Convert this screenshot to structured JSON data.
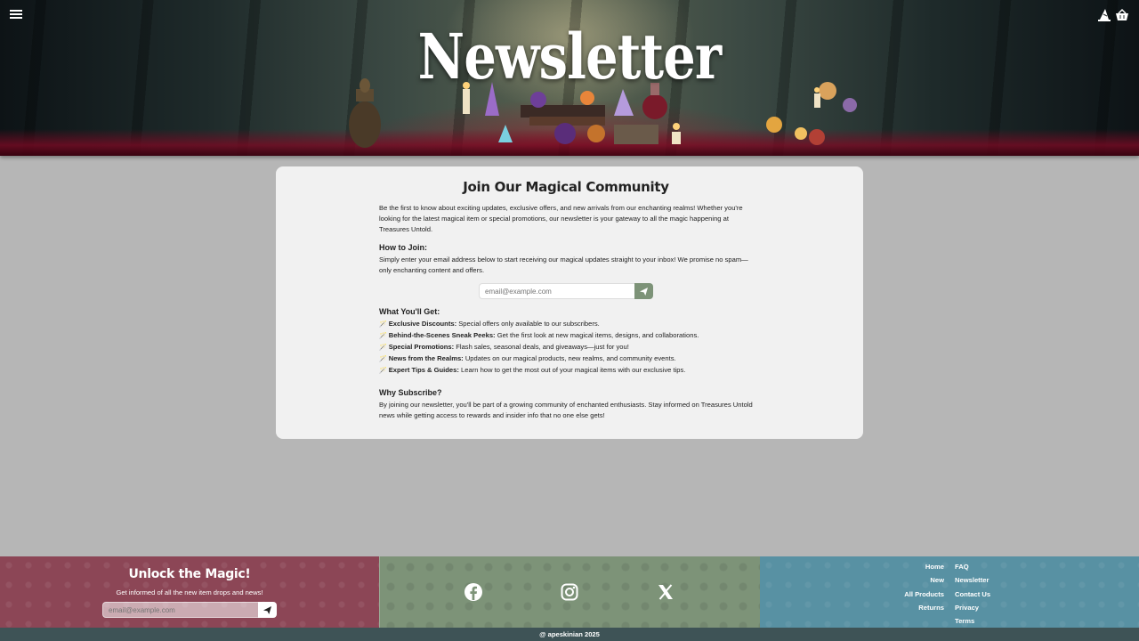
{
  "header": {
    "title": "Newsletter",
    "icons": [
      "menu-icon",
      "wizard-hat-icon",
      "basket-icon"
    ]
  },
  "card": {
    "title": "Join Our Magical Community",
    "intro": "Be the first to know about exciting updates, exclusive offers, and new arrivals from our enchanting realms! Whether you're looking for the latest magical item or special promotions, our newsletter is your gateway to all the magic happening at Treasures Untold.",
    "how_heading": "How to Join:",
    "how_text": "Simply enter your email address below to start receiving our magical updates straight to your inbox! We promise no spam—only enchanting content and offers.",
    "email_placeholder": "email@example.com",
    "get_heading": "What You'll Get:",
    "wand": "🪄",
    "benefits": [
      {
        "title": "Exclusive Discounts:",
        "text": " Special offers only available to our subscribers."
      },
      {
        "title": "Behind-the-Scenes Sneak Peeks:",
        "text": " Get the first look at new magical items, designs, and collaborations."
      },
      {
        "title": "Special Promotions:",
        "text": " Flash sales, seasonal deals, and giveaways—just for you!"
      },
      {
        "title": "News from the Realms:",
        "text": " Updates on our magical products, new realms, and community events."
      },
      {
        "title": "Expert Tips & Guides:",
        "text": " Learn how to get the most out of your magical items with our exclusive tips."
      }
    ],
    "why_heading": "Why Subscribe?",
    "why_text": "By joining our newsletter, you'll be part of a growing community of enchanted enthusiasts. Stay informed on Treasures Untold news while getting access to rewards and insider info that no one else gets!"
  },
  "footer": {
    "unlock_title": "Unlock the Magic!",
    "unlock_sub": "Get informed of all the new item drops and news!",
    "email_placeholder": "email@example.com",
    "social": [
      "facebook-icon",
      "instagram-icon",
      "x-icon"
    ],
    "links_left": [
      "Home",
      "New",
      "All Products",
      "Returns"
    ],
    "links_right": [
      "FAQ",
      "Newsletter",
      "Contact Us",
      "Privacy",
      "Terms"
    ],
    "copyright": "@ apeskinian 2025"
  },
  "colors": {
    "page_bg": "#b6b6b6",
    "card_bg": "#f1f1f1",
    "accent_green": "#7d9378",
    "footer_red": "#8c4656",
    "footer_blue": "#5891a3",
    "copyright_bg": "#3e5356"
  }
}
